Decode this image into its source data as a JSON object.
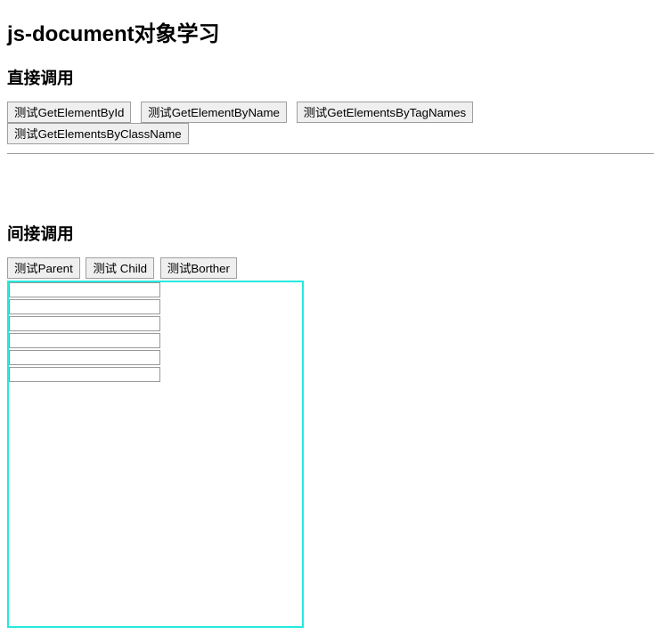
{
  "title": "js-document对象学习",
  "section1": {
    "heading": "直接调用",
    "buttons": {
      "b1": "测试GetElementById",
      "b2": "测试GetElementByName",
      "b3": "测试GetElementsByTagNames",
      "b4": "测试GetElementsByClassName"
    }
  },
  "section2": {
    "heading": "间接调用",
    "buttons": {
      "b1": "测试Parent",
      "b2": "测试 Child",
      "b3": "测试Borther"
    }
  },
  "colors": {
    "box_border": "#24eadc",
    "cell_border": "#999999"
  },
  "child_table_rows": 6
}
